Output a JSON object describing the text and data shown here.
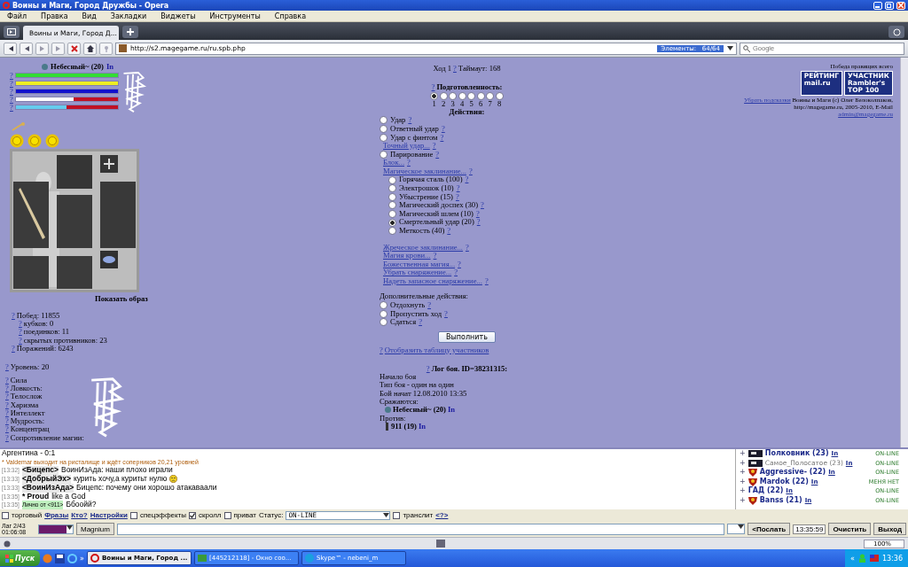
{
  "window": {
    "title": "Воины и Маги, Город Дружбы - Opera"
  },
  "menu": [
    "Файл",
    "Правка",
    "Вид",
    "Закладки",
    "Виджеты",
    "Инструменты",
    "Справка"
  ],
  "tabs": [
    {
      "label": "Воины и Маги, Город Д...",
      "selected": true
    }
  ],
  "address": {
    "url": "http://s2.magegame.ru/ru.spb.php",
    "elements": "Элементы:   64/64",
    "search_placeholder": "Google"
  },
  "player": {
    "name": "Небесный~ (20)",
    "link": "In",
    "bars": [
      {
        "help": "?",
        "color": "#33dd33",
        "level": 1
      },
      {
        "help": "?",
        "color": "#eeee22",
        "level": 1
      },
      {
        "help": "?",
        "color": "#1111cc",
        "level": 1
      },
      {
        "help": "?",
        "color": "#ffffff",
        "level": 0.57
      },
      {
        "help": "?",
        "color": "#66ccee",
        "level": 0.5
      }
    ]
  },
  "show_image": "Показать образ",
  "stats": [
    {
      "help": "?",
      "text": "Побед: 11855",
      "children": [
        {
          "help": "?",
          "text": "кубков: 0"
        },
        {
          "help": "?",
          "text": "поединков: 11"
        },
        {
          "help": "?",
          "text": "скрытых противников: 23"
        }
      ]
    },
    {
      "help": "?",
      "text": "Поражений: 6243"
    }
  ],
  "rank_line": {
    "help": "?",
    "text": "Уровень: 20"
  },
  "attributes": [
    {
      "help": "?",
      "text": "Сила"
    },
    {
      "help": "?",
      "text": "Ловкость:"
    },
    {
      "help": "?",
      "text": "Телослож"
    },
    {
      "help": "?",
      "text": "Харизма"
    },
    {
      "help": "?",
      "text": "Интеллект"
    },
    {
      "help": "?",
      "text": "Мудрость:"
    },
    {
      "help": "?",
      "text": "Концентрац"
    },
    {
      "help": "?",
      "text": "Сопротивление магии:"
    }
  ],
  "turn": {
    "text": "Ход 1",
    "help": "?",
    "timeout": "Таймаут: 168"
  },
  "readiness": {
    "help": "?",
    "title": "Подготовленность:",
    "options": [
      {
        "label": "1",
        "selected": true
      },
      {
        "label": "2",
        "selected": false
      },
      {
        "label": "3",
        "selected": false
      },
      {
        "label": "4",
        "selected": false
      },
      {
        "label": "5",
        "selected": false
      },
      {
        "label": "6",
        "selected": false
      },
      {
        "label": "7",
        "selected": false
      },
      {
        "label": "8",
        "selected": false
      }
    ]
  },
  "actions_title": "Действия:",
  "actions": [
    {
      "kind": "radio",
      "label": "Удар",
      "help": "?",
      "selected": false
    },
    {
      "kind": "radio",
      "label": "Ответный удар",
      "help": "?",
      "selected": false
    },
    {
      "kind": "radio",
      "label": "Удар с финтом",
      "help": "?",
      "selected": false
    },
    {
      "kind": "link",
      "label": "Точный удар...",
      "help": "?"
    },
    {
      "kind": "radio",
      "label": "Парирование",
      "help": "?",
      "selected": false
    },
    {
      "kind": "link",
      "label": "Блок...",
      "help": "?"
    },
    {
      "kind": "link",
      "label": "Магическое заклинание...",
      "help": "?",
      "children": [
        {
          "kind": "radio",
          "label": "Горячая сталь (100)",
          "help": "?",
          "selected": false
        },
        {
          "kind": "radio",
          "label": "Электрошок (10)",
          "help": "?",
          "selected": false
        },
        {
          "kind": "radio",
          "label": "Убыстрение (15)",
          "help": "?",
          "selected": false
        },
        {
          "kind": "radio",
          "label": "Магический доспех (30)",
          "help": "?",
          "selected": false
        },
        {
          "kind": "radio",
          "label": "Магический шлем (10)",
          "help": "?",
          "selected": false
        },
        {
          "kind": "radio",
          "label": "Смертельный удар (20)",
          "help": "?",
          "selected": true
        },
        {
          "kind": "radio",
          "label": "Меткость (40)",
          "help": "?",
          "selected": false
        }
      ]
    },
    {
      "kind": "link",
      "label": "Жреческое заклинание...",
      "help": "?"
    },
    {
      "kind": "link",
      "label": "Магия крови...",
      "help": "?"
    },
    {
      "kind": "link",
      "label": "Божественная магия...",
      "help": "?"
    },
    {
      "kind": "link",
      "label": "Убрать снаряжение...",
      "help": "?"
    },
    {
      "kind": "link",
      "label": "Надеть запасное снаряжение...",
      "help": "?"
    }
  ],
  "extra_title": "Дополнительные действия:",
  "extra_actions": [
    {
      "label": "Отдохнуть",
      "help": "?",
      "selected": false
    },
    {
      "label": "Пропустить ход",
      "help": "?",
      "selected": false
    },
    {
      "label": "Сдаться",
      "help": "?",
      "selected": false
    }
  ],
  "submit": "Выполнить",
  "participants_link": {
    "help": "?",
    "label": "Отобразить таблицу участников"
  },
  "log": {
    "help": "?",
    "title": "Лог боя. ID=38231315:",
    "lines": [
      "Начало боя",
      "Тип боя - один на один",
      "Бой начат 12.08.2010 13:35",
      "Сражаются:"
    ],
    "side_a": {
      "name": "Небесный~ (20)",
      "link": "In"
    },
    "against": "Против:",
    "side_b": {
      "name": "911 (19)",
      "link": "In"
    }
  },
  "info": {
    "headline": "Победа правящих всего",
    "badges": [
      {
        "top": "РЕЙТИНГ",
        "bottom": "mail.ru"
      },
      {
        "top": "УЧАСТНИК",
        "bottom": "Rambler's",
        "corner": "TOP 100"
      }
    ],
    "hide_hints": "Убрать подсказки",
    "copyright": "Воины и Маги (c) Олег Белоколпаков, http://magegame.ru, 2005-2010, E-Mail",
    "email": "admin@magegame.ru"
  },
  "chat": {
    "messages": [
      {
        "kind": "plain",
        "text": "Аргентина - 0:1"
      },
      {
        "kind": "system",
        "marker": "*",
        "text": "Valdemar выходит на ристалище и ждёт соперников 20,21 уровней"
      },
      {
        "kind": "message",
        "time": "[13:32]",
        "nick": "<Бицепс>",
        "text": "ВоинИзАда: наши плохо играли"
      },
      {
        "kind": "message",
        "time": "[13:33]",
        "nick": "<ДобрыйЭх>",
        "text": "курить хочу,а куритьт нулю",
        "smiley": true
      },
      {
        "kind": "message",
        "time": "[13:33]",
        "nick": "<ВоинИзАда>",
        "text": "Бицепс: почему они хорошо атакаваали"
      },
      {
        "kind": "action",
        "time": "[13:35]",
        "marker": "*",
        "nick": "Proud",
        "text": "like a God"
      },
      {
        "kind": "private",
        "time": "[13:35]",
        "from": "Лично от <911>",
        "text": "Ббоойй?"
      }
    ]
  },
  "users": [
    {
      "expand": "+",
      "kind": "flag",
      "name": "Полковник (23)",
      "link": "In",
      "status": "ON-LINE",
      "dimmed": false
    },
    {
      "expand": "+",
      "kind": "flag",
      "name": "Самое_Полосатое (23)",
      "link": "In",
      "status": "ON-LINE",
      "dimmed": true
    },
    {
      "expand": "+",
      "kind": "shield",
      "name": "Aggressive- (22)",
      "link": "In",
      "status": "ON-LINE",
      "dimmed": false
    },
    {
      "expand": "+",
      "kind": "shield",
      "name": "Mardok (22)",
      "link": "In",
      "status": "МЕНЯ НЕТ",
      "dimmed": false
    },
    {
      "expand": "+",
      "kind": "plain",
      "name": "ГАД (22)",
      "link": "In",
      "status": "ON-LINE",
      "dimmed": false
    },
    {
      "expand": "+",
      "kind": "shield",
      "name": "Banss (21)",
      "link": "In",
      "status": "ON-LINE",
      "dimmed": false
    }
  ],
  "controls": [
    {
      "kind": "checkbox",
      "label": "торговый",
      "checked": false
    },
    {
      "kind": "link",
      "label": "Фразы"
    },
    {
      "kind": "link",
      "label": "Кто?"
    },
    {
      "kind": "link",
      "label": "Настройки"
    },
    {
      "kind": "checkbox",
      "label": "спецэффекты",
      "checked": false
    },
    {
      "kind": "checkbox",
      "label": "скролл",
      "checked": true
    },
    {
      "kind": "checkbox",
      "label": "приват",
      "checked": false
    },
    {
      "kind": "select",
      "label": "Статус:",
      "value": "ON-LINE"
    },
    {
      "kind": "checkbox",
      "label": "транслит",
      "checked": false
    },
    {
      "kind": "link",
      "label": "<?>"
    }
  ],
  "input_row": {
    "lag": "Лаг 2/43",
    "elapsed": "01:06:08",
    "nick_button": "Magnium",
    "send": "<Послать",
    "clock": "13:35:59",
    "clear": "Очистить",
    "exit": "Выход"
  },
  "status_bar": {
    "zoom": "100%"
  },
  "taskbar": {
    "start": "Пуск",
    "more": "»",
    "tasks": [
      {
        "kind": "opera",
        "label": "Воины и Маги, Город ...",
        "selected": true
      },
      {
        "kind": "chat",
        "label": "[445212118] - Окно соо...",
        "selected": false
      },
      {
        "kind": "skype",
        "label": "Skype™ - nebeni_m",
        "selected": false
      }
    ],
    "tray_expand": "«",
    "time": "13:36"
  }
}
